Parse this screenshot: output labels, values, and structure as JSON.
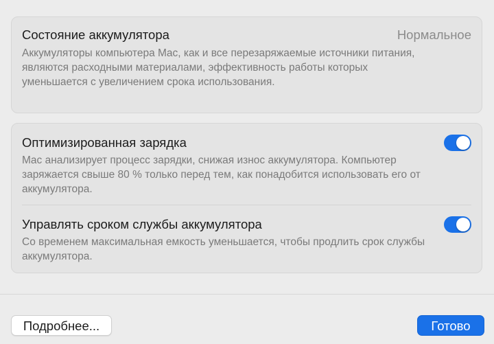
{
  "battery_health": {
    "title": "Состояние аккумулятора",
    "value": "Нормальное",
    "description": "Аккумуляторы компьютера Mac, как и все перезаряжаемые источники питания, являются расходными материалами, эффективность работы которых уменьшается с увеличением срока использования."
  },
  "optimized_charging": {
    "title": "Оптимизированная зарядка",
    "description": "Mac анализирует процесс зарядки, снижая износ аккумулятора. Компьютер заряжается свыше 80 % только перед тем, как понадобится использовать его от аккумулятора.",
    "enabled": true
  },
  "manage_lifespan": {
    "title": "Управлять сроком службы аккумулятора",
    "description": "Со временем максимальная емкость уменьшается, чтобы продлить срок службы аккумулятора.",
    "enabled": true
  },
  "footer": {
    "more_label": "Подробнее...",
    "done_label": "Готово"
  },
  "colors": {
    "accent": "#1a71e8",
    "background": "#ececec",
    "panel": "#e4e4e4",
    "secondary_text": "#7a7a7a"
  }
}
